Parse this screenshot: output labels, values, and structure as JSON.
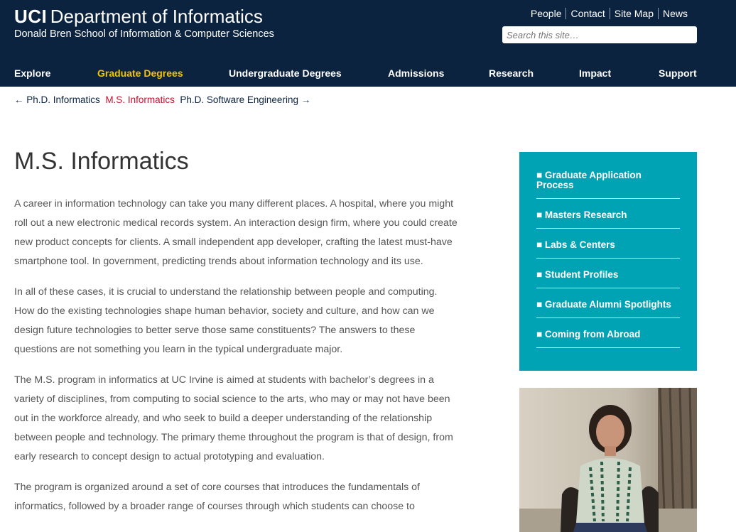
{
  "header": {
    "brand_uci": "UCI",
    "brand_dept": "Department of Informatics",
    "brand_school": "Donald Bren School of Information & Computer Sciences",
    "utility_links": [
      "People",
      "Contact",
      "Site Map",
      "News"
    ],
    "search_placeholder": "Search this site…"
  },
  "nav": {
    "items": [
      "Explore",
      "Graduate Degrees",
      "Undergraduate Degrees",
      "Admissions",
      "Research",
      "Impact",
      "Support"
    ],
    "active": "Graduate Degrees",
    "active_color": "#f1c400"
  },
  "pager": {
    "prev": "← Ph.D. Informatics",
    "current": "M.S. Informatics",
    "next": "Ph.D. Software Engineering →"
  },
  "page": {
    "title": "M.S. Informatics",
    "paragraphs": [
      "A career in information technology can take you many different places. A hospital, where you might roll out a new electronic medical records system. An interaction design firm, where you could create new product concepts for clients. A small independent app developer, crafting the latest must-have smartphone tool. In government, predicting trends about information technology and its use.",
      "In all of these cases, it is crucial to understand the relationship between people and computing. How do the existing technologies shape human behavior, society and culture, and how can we design future technologies to better serve those same constituents? The answers to these questions are not something you learn in the typical undergraduate major.",
      "The M.S. program in informatics at UC Irvine is aimed at students with bachelor’s degrees in a variety of disciplines, from computing to social science to the arts, who may or may not have been out in the workforce already, and who seek to build a deeper understanding of the relationship between people and technology. The primary theme throughout the program is that of design, from early research to concept design to actual prototyping and evaluation.",
      "The program is organized around a set of core courses that introduces the fundamentals of informatics, followed by a broader range of courses through which students can choose to"
    ]
  },
  "sidebar": {
    "links": [
      "■ Graduate Application Process",
      "■ Masters Research",
      "■ Labs & Centers",
      "■ Student Profiles",
      "■ Graduate Alumni Spotlights",
      "■ Coming from Abroad"
    ],
    "box_color": "#00a3b4"
  },
  "colors": {
    "header_bg": "#0c2340",
    "current_link": "#c8102e"
  }
}
